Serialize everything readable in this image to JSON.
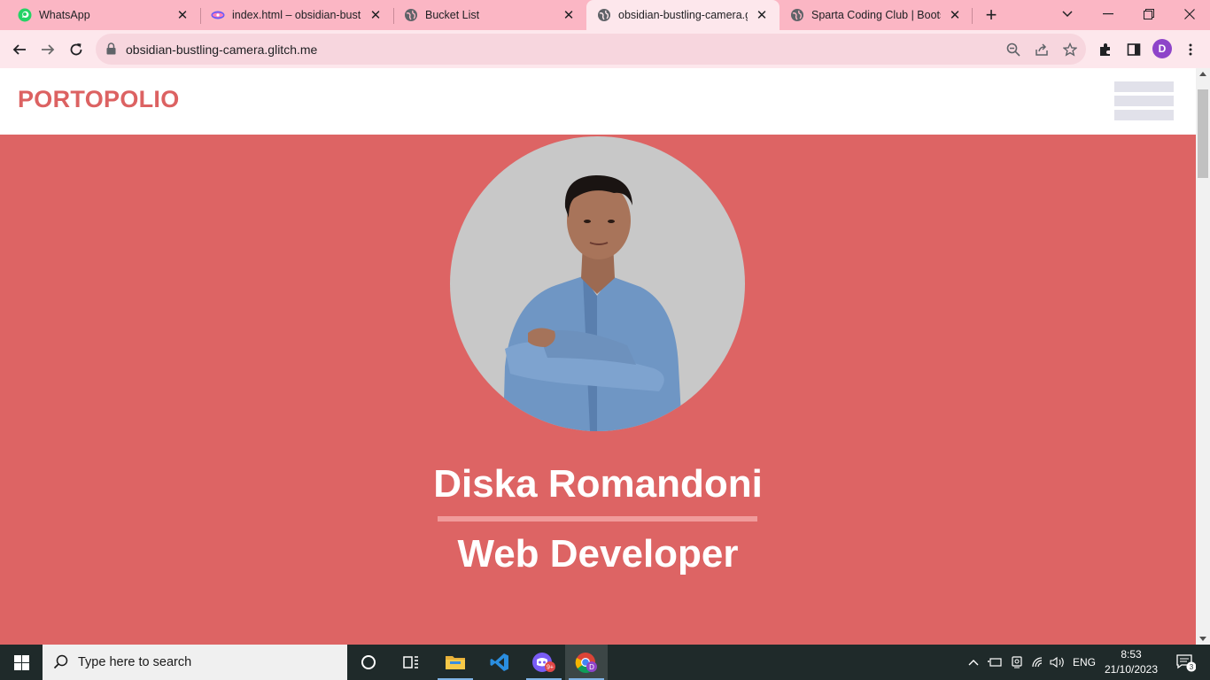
{
  "browser": {
    "tabs": [
      {
        "title": "WhatsApp",
        "icon": "whatsapp-icon"
      },
      {
        "title": "index.html – obsidian-bustling",
        "icon": "glitch-icon"
      },
      {
        "title": "Bucket List",
        "icon": "globe-icon"
      },
      {
        "title": "obsidian-bustling-camera.glitch",
        "icon": "globe-icon",
        "active": true
      },
      {
        "title": "Sparta Coding Club | Bootstrap",
        "icon": "globe-icon"
      }
    ],
    "url": "obsidian-bustling-camera.glitch.me",
    "profile_initial": "D"
  },
  "page": {
    "brand": "PORTOPOLIO",
    "name": "Diska Romandoni",
    "role": "Web Developer",
    "colors": {
      "accent": "#dd6464",
      "brand_text": "#dc6262",
      "divider": "#f09b9b"
    }
  },
  "taskbar": {
    "search_placeholder": "Type here to search",
    "discord_badge": "9+",
    "language": "ENG",
    "time": "8:53",
    "date": "21/10/2023",
    "notification_count": "3"
  }
}
